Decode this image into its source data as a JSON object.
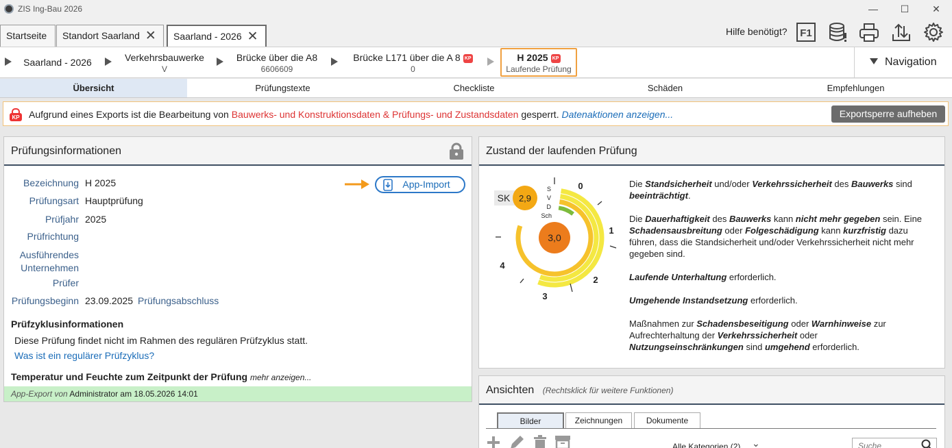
{
  "window": {
    "title": "ZIS Ing-Bau 2026",
    "min": "—",
    "max": "☐",
    "close": "✕"
  },
  "tabs": [
    {
      "label": "Startseite",
      "closable": false
    },
    {
      "label": "Standort Saarland",
      "closable": true
    },
    {
      "label": "Saarland - 2026",
      "closable": true
    }
  ],
  "toolbar": {
    "help_label": "Hilfe benötigt?",
    "icons": [
      "help-f1-icon",
      "database-icon",
      "print-icon",
      "export-icon",
      "settings-icon"
    ]
  },
  "breadcrumb": [
    {
      "title": "Saarland - 2026",
      "sub": ""
    },
    {
      "title": "Verkehrsbauwerke",
      "sub": "V"
    },
    {
      "title": "Brücke über die A8",
      "sub": "6606609"
    },
    {
      "title": "Brücke L171 über die A 8",
      "sub": "0",
      "locked": true
    },
    {
      "title": "H 2025",
      "sub": "Laufende Prüfung",
      "locked": true
    }
  ],
  "navigation_label": "Navigation",
  "kp_badge": "KP",
  "subtabs": [
    "Übersicht",
    "Prüfungstexte",
    "Checkliste",
    "Schäden",
    "Empfehlungen"
  ],
  "alert": {
    "text_before": "Aufgrund eines Exports ist die Bearbeitung von ",
    "highlight": "Bauwerks- und Konstruktionsdaten & Prüfungs- und Zustandsdaten",
    "text_after": " gesperrt. ",
    "link": "Datenaktionen anzeigen...",
    "button": "Exportsperre aufheben"
  },
  "pruefung": {
    "title": "Prüfungsinformationen",
    "app_import": "App-Import",
    "fields": [
      {
        "label": "Bezeichnung",
        "value": "H 2025"
      },
      {
        "label": "Prüfungsart",
        "value": "Hauptprüfung"
      },
      {
        "label": "Prüfjahr",
        "value": "2025"
      },
      {
        "label": "Prüfrichtung",
        "value": ""
      },
      {
        "label": "Ausführendes Unternehmen",
        "value": ""
      },
      {
        "label": "Prüfer",
        "value": ""
      },
      {
        "label": "Prüfungsbeginn",
        "value": "23.09.2025"
      }
    ],
    "abschluss_label": "Prüfungsabschluss",
    "zyklus_title": "Prüfzyklusinformationen",
    "zyklus_text": "Diese Prüfung findet nicht im Rahmen des regulären Prüfzyklus statt.",
    "zyklus_link": "Was ist ein regulärer Prüfzyklus?",
    "temp_title": "Temperatur und Feuchte zum Zeitpunkt der Prüfung",
    "temp_more": "mehr anzeigen...",
    "footer_prefix": "App-Export von",
    "footer_text": "Administrator am 18.05.2026 14:01"
  },
  "zustand": {
    "title": "Zustand der laufenden Prüfung",
    "sk_label": "SK",
    "sk_value": "2,9",
    "center_value": "3,0",
    "arcs": [
      {
        "label": "S",
        "level": 0.0,
        "color": "#f4e842"
      },
      {
        "label": "V",
        "level": 0.0,
        "color": "#f4e842"
      },
      {
        "label": "D",
        "level": 2.0,
        "color": "#f6c22c"
      },
      {
        "label": "Sch",
        "level": 1.0,
        "color": "#7dbb3c"
      }
    ],
    "scale": [
      "0",
      "1",
      "2",
      "3",
      "4",
      "–"
    ],
    "desc": [
      [
        {
          "t": "Die "
        },
        {
          "b": "Standsicherheit"
        },
        {
          "t": " und/oder "
        },
        {
          "b": "Verkehrssicherheit"
        },
        {
          "t": " des "
        },
        {
          "b": "Bauwerks"
        },
        {
          "t": " sind "
        },
        {
          "b": "beeinträchtigt"
        },
        {
          "t": "."
        }
      ],
      [
        {
          "t": "Die "
        },
        {
          "b": "Dauerhaftigkeit"
        },
        {
          "t": " des "
        },
        {
          "b": "Bauwerks"
        },
        {
          "t": " kann "
        },
        {
          "b": "nicht mehr gegeben"
        },
        {
          "t": " sein. Eine "
        },
        {
          "b": "Schadensausbreitung"
        },
        {
          "t": " oder "
        },
        {
          "b": "Folgeschädigung"
        },
        {
          "t": " kann "
        },
        {
          "b": "kurzfristig"
        },
        {
          "t": " dazu führen, dass die Standsicherheit und/oder Verkehrssicherheit nicht mehr gegeben sind."
        }
      ],
      [
        {
          "b": "Laufende Unterhaltung"
        },
        {
          "t": " erforderlich."
        }
      ],
      [
        {
          "b": "Umgehende Instandsetzung"
        },
        {
          "t": " erforderlich."
        }
      ],
      [
        {
          "t": "Maßnahmen zur "
        },
        {
          "b": "Schadensbeseitigung"
        },
        {
          "t": " oder "
        },
        {
          "b": "Warnhinweise"
        },
        {
          "t": " zur Aufrechterhaltung der "
        },
        {
          "b": "Verkehrssicherheit"
        },
        {
          "t": " oder "
        },
        {
          "b": "Nutzungseinschränkungen"
        },
        {
          "t": " sind "
        },
        {
          "b": "umgehend"
        },
        {
          "t": " erforderlich."
        }
      ]
    ]
  },
  "ansichten": {
    "title": "Ansichten",
    "hint": "(Rechtsklick für weitere Funktionen)",
    "tabs": [
      "Bilder",
      "Zeichnungen",
      "Dokumente"
    ],
    "category": "Alle Kategorien (2)",
    "search_placeholder": "Suche"
  }
}
